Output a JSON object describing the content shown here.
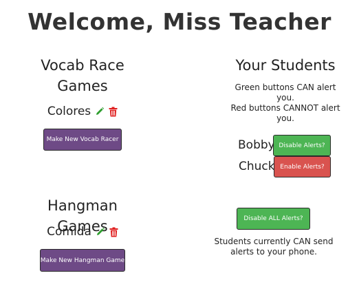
{
  "header": {
    "title": "Welcome, Miss Teacher"
  },
  "vocab": {
    "title_line1": "Vocab Race",
    "title_line2": "Games",
    "games": [
      {
        "name": "Colores"
      }
    ],
    "new_button_label": "Make New Vocab Racer"
  },
  "hangman": {
    "title": "Hangman Games",
    "games": [
      {
        "name": "Comida"
      }
    ],
    "new_button_label": "Make New Hangman Game"
  },
  "students": {
    "title": "Your Students",
    "help_line1": "Green buttons CAN alert",
    "help_line2": "you.",
    "help_line3": "Red buttons CANNOT alert",
    "help_line4": "you.",
    "list": [
      {
        "name": "Bobby",
        "button_label": "Disable Alerts?",
        "status": "green"
      },
      {
        "name": "Chuck",
        "button_label": "Enable Alerts?",
        "status": "red"
      }
    ]
  },
  "alerts": {
    "disable_all_label": "Disable ALL Alerts?",
    "status_line1": "Students currently CAN send",
    "status_line2": "alerts to your phone."
  },
  "colors": {
    "purple_button": "#6e4a86",
    "green_button": "#4db554",
    "red_button": "#d9534f",
    "edit_icon": "#2e9e2e",
    "delete_icon": "#e02020"
  }
}
